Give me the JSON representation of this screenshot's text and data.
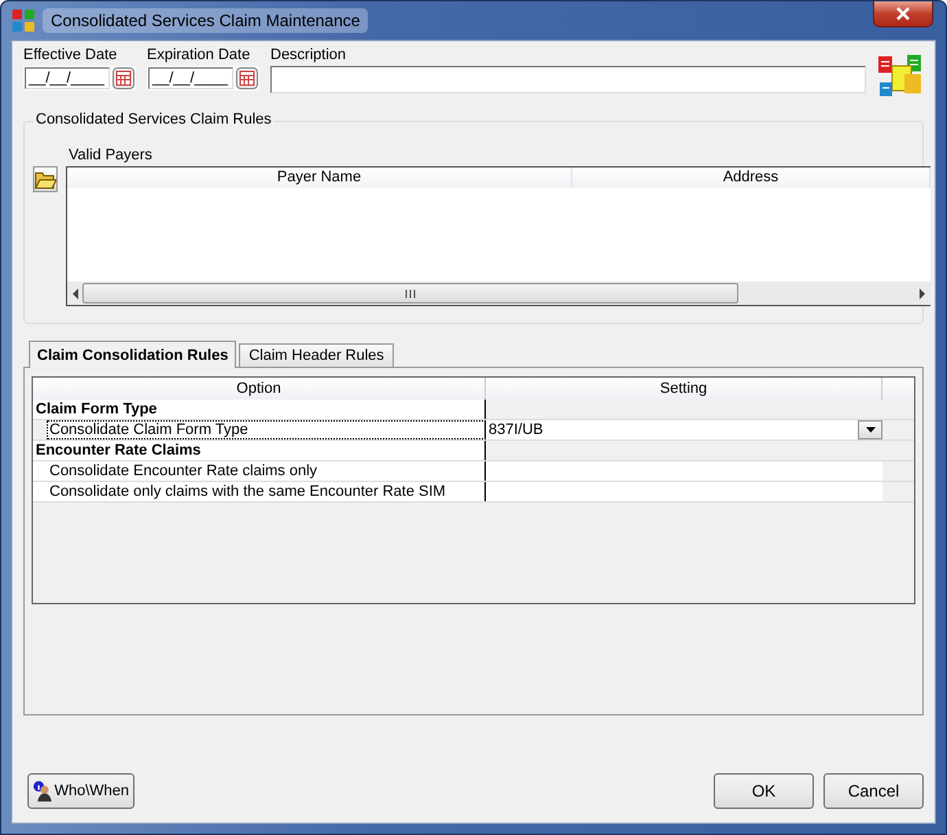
{
  "window": {
    "title": "Consolidated Services Claim Maintenance"
  },
  "fields": [
    {
      "kind": "date",
      "label": "Effective Date",
      "value": "__/__/____"
    },
    {
      "kind": "date",
      "label": "Expiration Date",
      "value": "__/__/____"
    },
    {
      "kind": "text",
      "label": "Description"
    }
  ],
  "rules_group": {
    "title": "Consolidated Services Claim Rules",
    "list_label": "Valid Payers",
    "columns": [
      "Payer Name",
      "Address"
    ]
  },
  "tabs": [
    {
      "label": "Claim Consolidation Rules",
      "selected": true
    },
    {
      "label": "Claim Header Rules",
      "selected": false
    }
  ],
  "options_grid": {
    "columns": [
      "Option",
      "Setting"
    ],
    "rows": [
      {
        "kind": "group",
        "option": "Claim Form Type",
        "selected": false
      },
      {
        "kind": "combo",
        "option": "Consolidate Claim Form Type",
        "setting": "837I/UB",
        "selected": true
      },
      {
        "kind": "group",
        "option": "Encounter Rate Claims",
        "selected": false
      },
      {
        "kind": "text",
        "option": "Consolidate Encounter Rate claims  only",
        "selected": false
      },
      {
        "kind": "text",
        "option": "Consolidate only claims with the same Encounter Rate SIM",
        "selected": false
      }
    ]
  },
  "buttons": [
    {
      "kind": "who",
      "label": "Who\\When"
    },
    {
      "kind": "plain",
      "label": "OK"
    },
    {
      "kind": "plain",
      "label": "Cancel"
    }
  ]
}
